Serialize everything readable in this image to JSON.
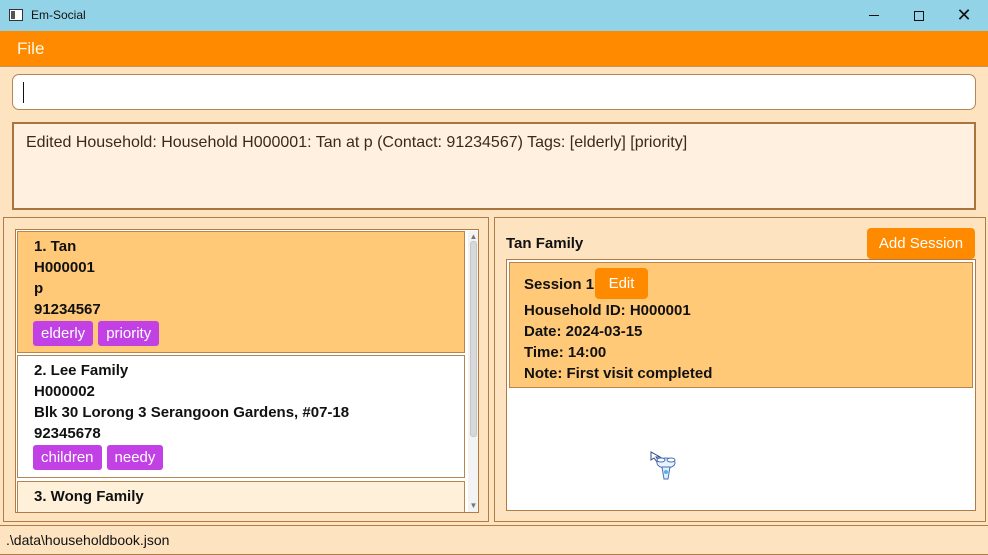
{
  "window": {
    "title": "Em-Social",
    "icons": [
      "app-icon",
      "minimize-icon",
      "maximize-icon",
      "close-icon"
    ]
  },
  "menu": {
    "file_label": "File"
  },
  "command": {
    "value": ""
  },
  "result": {
    "text": "Edited Household: Household H000001: Tan at p (Contact: 91234567) Tags: [elderly] [priority]"
  },
  "households": [
    {
      "index_name": "1.  Tan",
      "id": "H000001",
      "address": "p",
      "contact": "91234567",
      "tags": [
        "elderly",
        "priority"
      ]
    },
    {
      "index_name": "2.  Lee Family",
      "id": "H000002",
      "address": "Blk 30 Lorong 3 Serangoon Gardens, #07-18",
      "contact": "92345678",
      "tags": [
        "children",
        "needy"
      ]
    },
    {
      "index_name": "3.  Wong Family"
    }
  ],
  "details": {
    "family_name": "Tan Family",
    "add_session_label": "Add Session",
    "session": {
      "label": "Session 1",
      "edit_label": "Edit",
      "household_id": "Household ID: H000001",
      "date": "Date: 2024-03-15",
      "time": "Time: 14:00",
      "note": "Note: First visit completed"
    }
  },
  "status": {
    "path": ".\\data\\householdbook.json"
  },
  "colors": {
    "accent": "#ff8a00",
    "titlebar": "#93d3e7",
    "selected_card": "#ffc978",
    "tag": "#c141e5",
    "panel_bg": "#fde3bf"
  }
}
